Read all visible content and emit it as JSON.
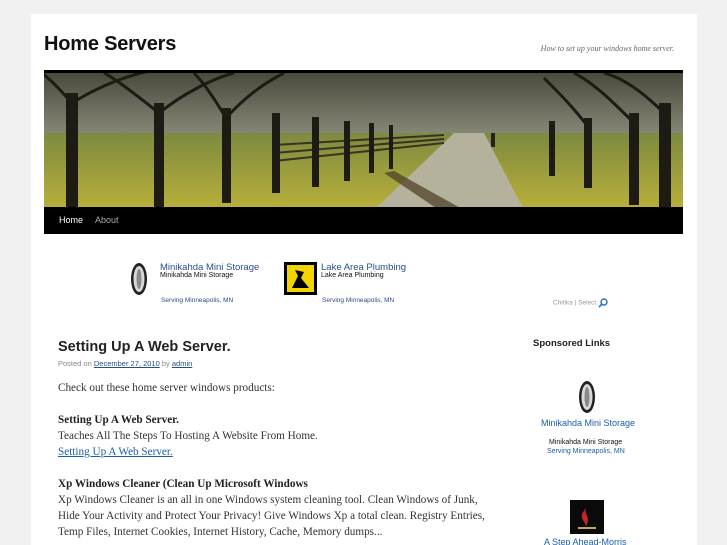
{
  "header": {
    "site_title": "Home Servers",
    "tagline": "How to set up your windows home server."
  },
  "nav": {
    "items": [
      {
        "label": "Home"
      },
      {
        "label": "About"
      }
    ]
  },
  "top_ads": [
    {
      "title": "Minikahda Mini Storage",
      "subtitle": "Minikahda Mini Storage",
      "location": "Serving Minneapolis, MN"
    },
    {
      "title": "Lake Area Plumbing",
      "subtitle": "Lake Area Plumbing",
      "location": "Serving Minneapolis, MN"
    }
  ],
  "chitika": "Chitika | Select",
  "post": {
    "title": "Setting Up A Web Server.",
    "posted_on": "Posted on",
    "date": "December 27, 2010",
    "by": "by",
    "author": "admin",
    "intro": "Check out these home server windows products:",
    "products": [
      {
        "heading": "Setting Up A Web Server.",
        "description": "Teaches All The Steps To Hosting A Website From Home.",
        "link": "Setting Up A Web Server."
      },
      {
        "heading": "Xp Windows Cleaner (Clean Up Microsoft Windows",
        "description": "Xp Windows Cleaner is an all in one Windows system cleaning tool. Clean Windows of Junk, Hide Your Activity and Protect Your Privacy! Give Windows Xp a total clean. Registry Entries, Temp Files, Internet Cookies, Internet History, Cache, Memory dumps..."
      }
    ]
  },
  "sidebar": {
    "title": "Sponsored Links",
    "ads": [
      {
        "title": "Minikahda Mini Storage",
        "subtitle": "Minikahda Mini Storage",
        "location": "Serving Minneapolis, MN"
      },
      {
        "title": "A Step Ahead-Morris"
      }
    ]
  },
  "colors": {
    "link": "#1b5eab",
    "nav_bg": "#000000",
    "page_bg": "#f1f1f1"
  }
}
